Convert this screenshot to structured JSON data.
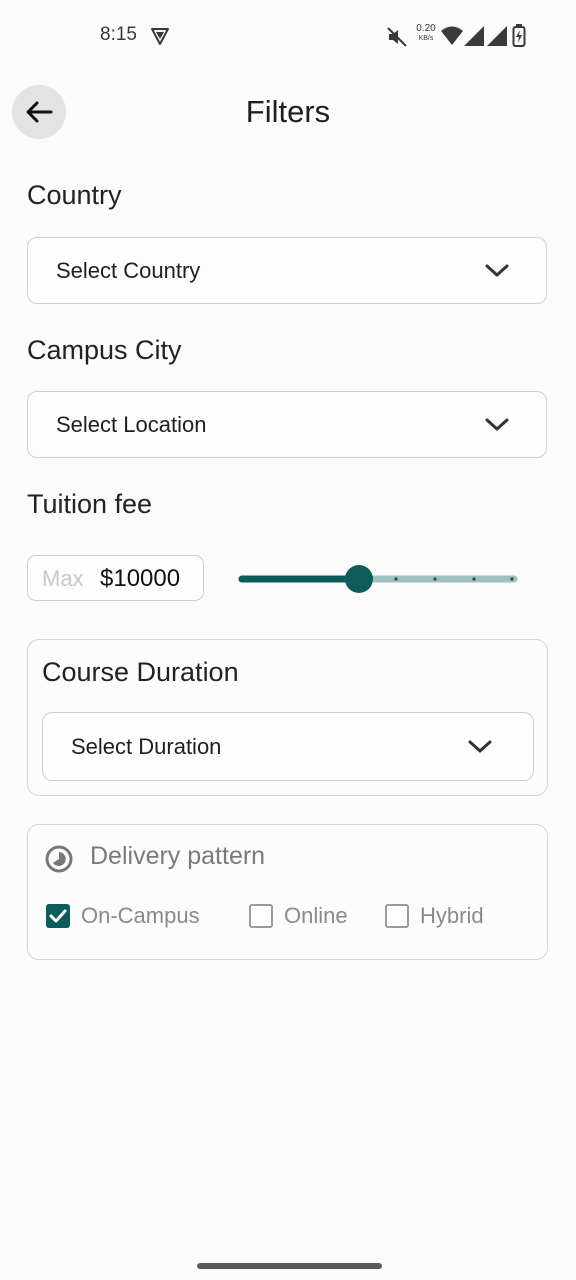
{
  "status_bar": {
    "time": "8:15",
    "speed_value": "0.20",
    "speed_unit": "KB/s"
  },
  "header": {
    "title": "Filters"
  },
  "country": {
    "label": "Country",
    "placeholder": "Select Country"
  },
  "campus_city": {
    "label": "Campus City",
    "placeholder": "Select Location"
  },
  "tuition": {
    "label": "Tuition fee",
    "max_placeholder": "Max",
    "max_value": "$10000",
    "slider_fraction": 0.43
  },
  "course_duration": {
    "label": "Course Duration",
    "placeholder": "Select Duration"
  },
  "delivery": {
    "label": "Delivery pattern",
    "options": [
      {
        "label": "On-Campus",
        "checked": true
      },
      {
        "label": "Online",
        "checked": false
      },
      {
        "label": "Hybrid",
        "checked": false
      }
    ]
  },
  "colors": {
    "accent": "#0d5c5c",
    "slider_track_inactive": "#9fc1c1"
  }
}
